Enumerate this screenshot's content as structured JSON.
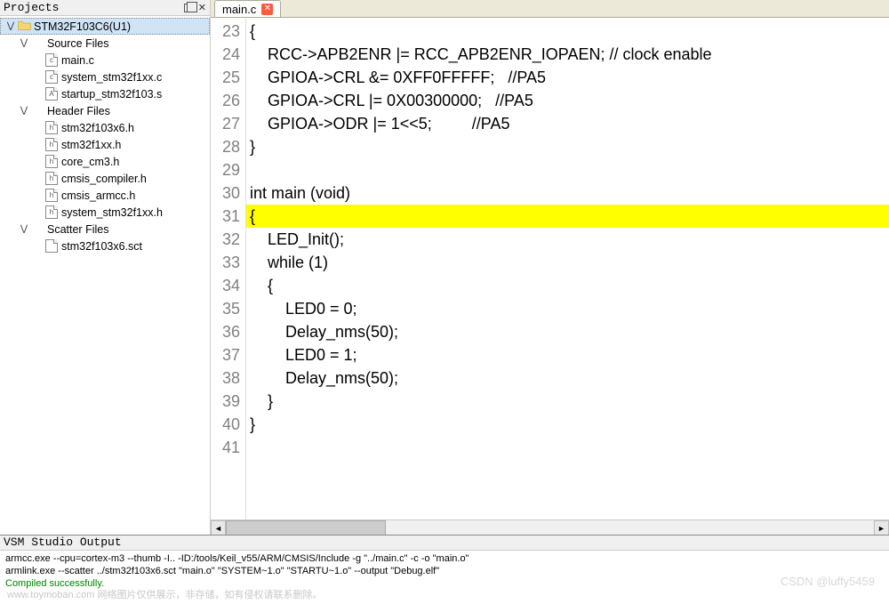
{
  "projects": {
    "title": "Projects",
    "root": {
      "label": "STM32F103C6(U1)"
    },
    "groups": [
      {
        "label": "Source Files",
        "items": [
          {
            "label": "main.c",
            "glyph": "c"
          },
          {
            "label": "system_stm32f1xx.c",
            "glyph": "c"
          },
          {
            "label": "startup_stm32f103.s",
            "glyph": "A"
          }
        ]
      },
      {
        "label": "Header Files",
        "items": [
          {
            "label": "stm32f103x6.h",
            "glyph": "h"
          },
          {
            "label": "stm32f1xx.h",
            "glyph": "h"
          },
          {
            "label": "core_cm3.h",
            "glyph": "h"
          },
          {
            "label": "cmsis_compiler.h",
            "glyph": "h"
          },
          {
            "label": "cmsis_armcc.h",
            "glyph": "h"
          },
          {
            "label": "system_stm32f1xx.h",
            "glyph": "h"
          }
        ]
      },
      {
        "label": "Scatter Files",
        "items": [
          {
            "label": "stm32f103x6.sct",
            "glyph": ""
          }
        ]
      }
    ]
  },
  "editor": {
    "tab_label": "main.c",
    "first_line_number": 23,
    "highlight_index": 9,
    "lines": [
      "{",
      "    RCC->APB2ENR |= RCC_APB2ENR_IOPAEN; // clock enable",
      "    GPIOA->CRL &= 0XFF0FFFFF;   //PA5",
      "    GPIOA->CRL |= 0X00300000;   //PA5",
      "    GPIOA->ODR |= 1<<5;         //PA5",
      "}",
      "",
      "int main (void)",
      "{ ",
      "    LED_Init();",
      "    while (1)",
      "    {",
      "        LED0 = 0;",
      "        Delay_nms(50);",
      "        LED0 = 1;",
      "        Delay_nms(50);",
      "    }",
      "}",
      ""
    ]
  },
  "output": {
    "title": "VSM Studio Output",
    "lines": [
      "armcc.exe --cpu=cortex-m3 --thumb -I.. -ID:/tools/Keil_v55/ARM/CMSIS/Include -g  \"../main.c\" -c -o \"main.o\"",
      "armlink.exe  --scatter ../stm32f103x6.sct  \"main.o\" \"SYSTEM~1.o\" \"STARTU~1.o\" --output \"Debug.elf\""
    ],
    "success": "Compiled successfully."
  },
  "watermarks": {
    "left": "www.toymoban.com 网络图片仅供展示，非存储，如有侵权请联系删除。",
    "right": "CSDN @luffy5459"
  }
}
